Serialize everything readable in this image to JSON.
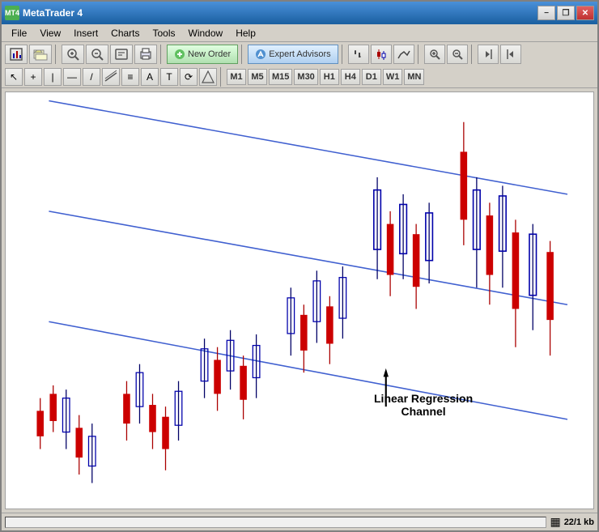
{
  "window": {
    "title": "MetaTrader 4",
    "icon_label": "MT",
    "title_btn_minimize": "−",
    "title_btn_restore": "❐",
    "title_btn_close": "✕"
  },
  "menu": {
    "items": [
      "File",
      "View",
      "Insert",
      "Charts",
      "Tools",
      "Window",
      "Help"
    ]
  },
  "toolbar1": {
    "new_order_label": "New Order",
    "expert_advisors_label": "Expert Advisors"
  },
  "timeframes": [
    "M1",
    "M5",
    "M15",
    "M30",
    "H1",
    "H4",
    "D1",
    "W1",
    "MN"
  ],
  "chart_annotation": {
    "line1": "Linear Regression",
    "line2": "Channel"
  },
  "status": {
    "info": "22/1 kb"
  },
  "tools": [
    "↖",
    "+",
    "|",
    "—",
    "/",
    "⌖",
    "≡",
    "A",
    "T",
    "⟳"
  ]
}
